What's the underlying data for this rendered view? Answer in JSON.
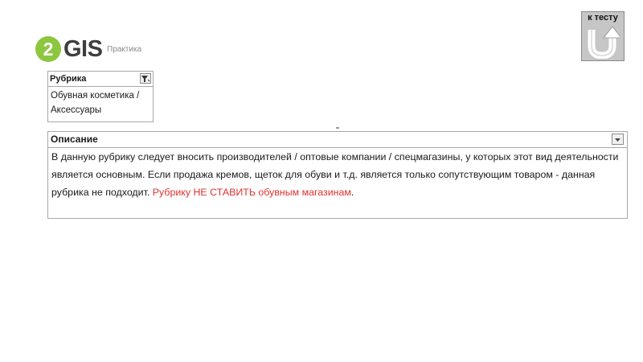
{
  "logo": {
    "badge": "2",
    "brand": "GIS",
    "subtitle": "Практика"
  },
  "back_button": {
    "label": "к тесту",
    "icon": "u-turn-arrow-icon"
  },
  "rubric_table": {
    "header": "Рубрика",
    "filter_icon": "filter-icon",
    "value_line1": "Обувная косметика /",
    "value_line2": "Аксессуары"
  },
  "description_table": {
    "header": "Описание",
    "dropdown_icon": "chevron-down-icon",
    "text_part1": "В данную рубрику следует вносить производителей / оптовые компании / спецмагазины, у которых этот вид деятельности является основным. Если продажа кремов, щеток для обуви и т.д. является только сопутствующим товаром - данная рубрика не подходит. ",
    "text_highlight": "Рубрику НЕ СТАВИТЬ обувным магазинам",
    "text_end": "."
  },
  "colors": {
    "logo_green": "#8dc63f",
    "logo_text": "#3e3e3e",
    "highlight_red": "#e03030",
    "button_bg": "#c6c6c6"
  }
}
